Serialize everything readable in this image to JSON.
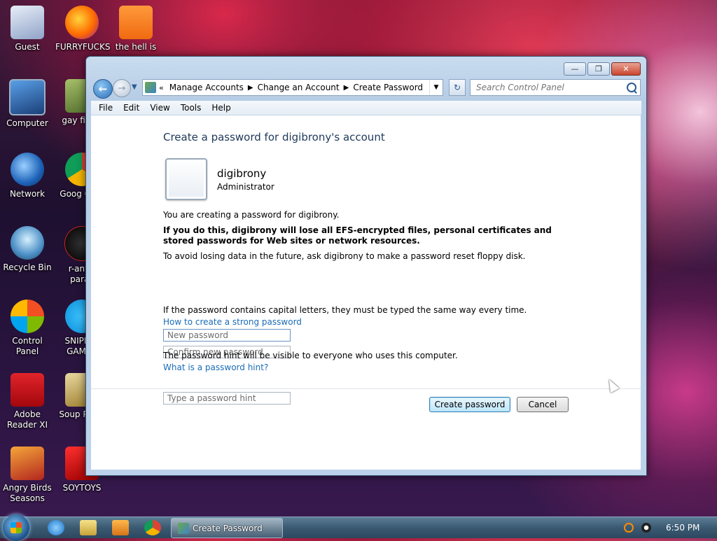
{
  "desktop": {
    "icons": [
      {
        "label": "Guest"
      },
      {
        "label": "FURRYFUCKS"
      },
      {
        "label": "the hell is"
      },
      {
        "label": "Computer"
      },
      {
        "label": "gay fi por"
      },
      {
        "label": "Network"
      },
      {
        "label": "Goog Chro"
      },
      {
        "label": "Recycle Bin"
      },
      {
        "label": "r-antiv parac"
      },
      {
        "label": "Control Panel"
      },
      {
        "label": "SNIPED! GAMER"
      },
      {
        "label": "Adobe Reader XI"
      },
      {
        "label": "Soup Plays"
      },
      {
        "label": "Angry Birds Seasons"
      },
      {
        "label": "SOYTOYS"
      }
    ]
  },
  "window": {
    "breadcrumbs": [
      "Manage Accounts",
      "Change an Account",
      "Create Password"
    ],
    "search_placeholder": "Search Control Panel",
    "menu": [
      "File",
      "Edit",
      "View",
      "Tools",
      "Help"
    ],
    "heading": "Create a password for digibrony's account",
    "user": {
      "name": "digibrony",
      "role": "Administrator"
    },
    "intro": "You are creating a password for digibrony.",
    "warning": "If you do this, digibrony will lose all EFS-encrypted files, personal certificates and stored passwords for Web sites or network resources.",
    "tip": "To avoid losing data in the future, ask digibrony to make a password reset floppy disk.",
    "new_password_placeholder": "New password",
    "confirm_password_placeholder": "Confirm new password",
    "caps_note": "If the password contains capital letters, they must be typed the same way every time.",
    "strong_link": "How to create a strong password",
    "hint_placeholder": "Type a password hint",
    "hint_note": "The password hint will be visible to everyone who uses this computer.",
    "hint_link": "What is a password hint?",
    "create_button": "Create password",
    "cancel_button": "Cancel"
  },
  "taskbar": {
    "active_task": "Create Password",
    "clock": "6:50 PM"
  },
  "colors": {
    "heading": "#1e395b",
    "link": "#1a6cb7",
    "taskbar": "#3b5a72"
  }
}
